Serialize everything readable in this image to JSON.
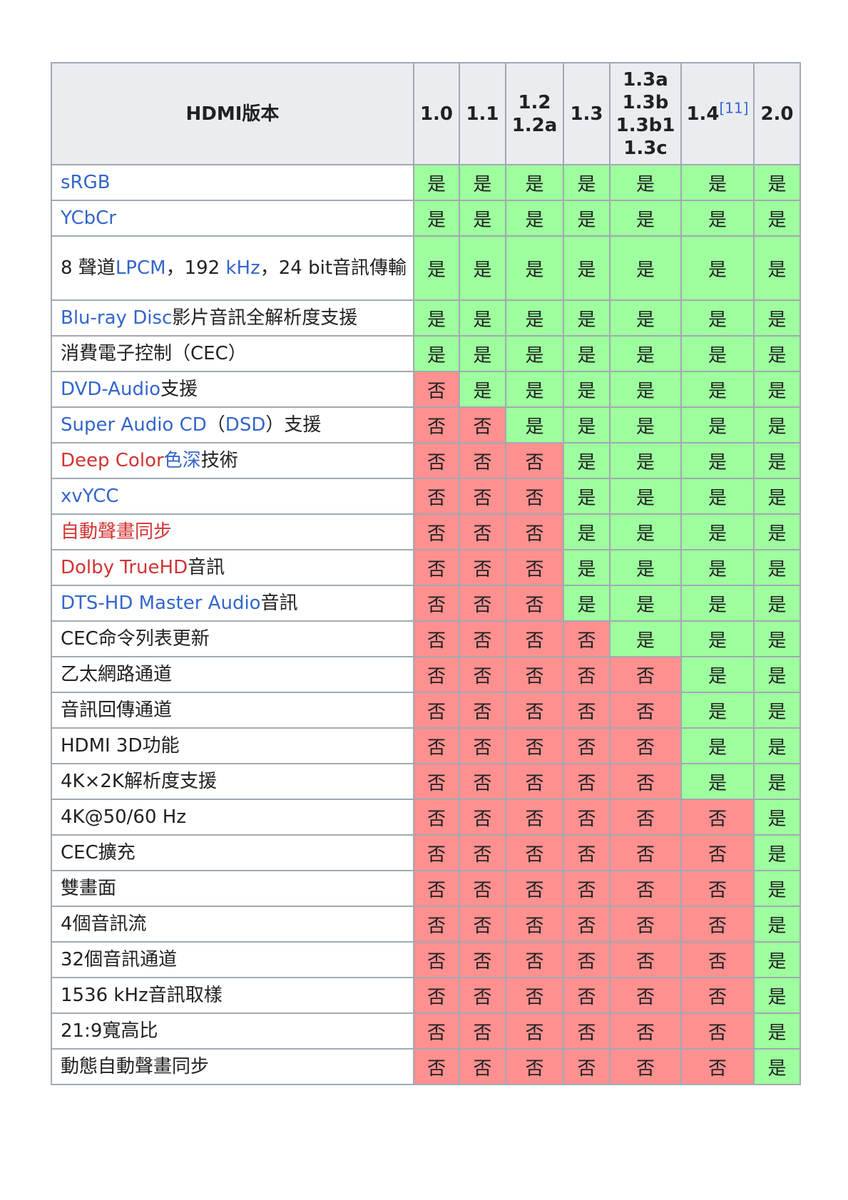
{
  "table": {
    "header_label": "HDMI版本",
    "versions": [
      {
        "lines": [
          "1.0"
        ]
      },
      {
        "lines": [
          "1.1"
        ]
      },
      {
        "lines": [
          "1.2",
          "1.2a"
        ]
      },
      {
        "lines": [
          "1.3"
        ]
      },
      {
        "lines": [
          "1.3a",
          "1.3b",
          "1.3b1",
          "1.3c"
        ]
      },
      {
        "lines": [
          "1.4"
        ],
        "ref": "[11]"
      },
      {
        "lines": [
          "2.0"
        ]
      }
    ],
    "yes_label": "是",
    "no_label": "否",
    "colors": {
      "yes_bg": "#9eff9e",
      "no_bg": "#ff9090",
      "header_bg": "#eaecf0",
      "link": "#3366cc",
      "new_link": "#d33333",
      "border": "#a2a9b1"
    },
    "rows": [
      {
        "segments": [
          {
            "text": "sRGB",
            "style": "link"
          }
        ],
        "support": [
          1,
          1,
          1,
          1,
          1,
          1,
          1
        ]
      },
      {
        "segments": [
          {
            "text": "YCbCr",
            "style": "link"
          }
        ],
        "support": [
          1,
          1,
          1,
          1,
          1,
          1,
          1
        ]
      },
      {
        "segments": [
          {
            "text": "8 聲道",
            "style": "plain"
          },
          {
            "text": "LPCM",
            "style": "link"
          },
          {
            "text": "，192 ",
            "style": "plain"
          },
          {
            "text": "kHz",
            "style": "link"
          },
          {
            "text": "，24 bit音訊傳輸",
            "style": "plain"
          }
        ],
        "support": [
          1,
          1,
          1,
          1,
          1,
          1,
          1
        ],
        "tall": true
      },
      {
        "segments": [
          {
            "text": "Blu-ray Disc",
            "style": "link"
          },
          {
            "text": "影片音訊全解析度支援",
            "style": "plain"
          }
        ],
        "support": [
          1,
          1,
          1,
          1,
          1,
          1,
          1
        ]
      },
      {
        "segments": [
          {
            "text": "消費電子控制（CEC）",
            "style": "plain"
          }
        ],
        "support": [
          1,
          1,
          1,
          1,
          1,
          1,
          1
        ]
      },
      {
        "segments": [
          {
            "text": "DVD-Audio",
            "style": "link"
          },
          {
            "text": "支援",
            "style": "plain"
          }
        ],
        "support": [
          0,
          1,
          1,
          1,
          1,
          1,
          1
        ]
      },
      {
        "segments": [
          {
            "text": "Super Audio CD",
            "style": "link"
          },
          {
            "text": "（",
            "style": "plain"
          },
          {
            "text": "DSD",
            "style": "link"
          },
          {
            "text": "）支援",
            "style": "plain"
          }
        ],
        "support": [
          0,
          0,
          1,
          1,
          1,
          1,
          1
        ]
      },
      {
        "segments": [
          {
            "text": "Deep Color",
            "style": "new"
          },
          {
            "text": "色深",
            "style": "link"
          },
          {
            "text": "技術",
            "style": "plain"
          }
        ],
        "support": [
          0,
          0,
          0,
          1,
          1,
          1,
          1
        ]
      },
      {
        "segments": [
          {
            "text": "xvYCC",
            "style": "link"
          }
        ],
        "support": [
          0,
          0,
          0,
          1,
          1,
          1,
          1
        ]
      },
      {
        "segments": [
          {
            "text": "自動聲畫同步",
            "style": "new"
          }
        ],
        "support": [
          0,
          0,
          0,
          1,
          1,
          1,
          1
        ]
      },
      {
        "segments": [
          {
            "text": "Dolby TrueHD",
            "style": "new"
          },
          {
            "text": "音訊",
            "style": "plain"
          }
        ],
        "support": [
          0,
          0,
          0,
          1,
          1,
          1,
          1
        ]
      },
      {
        "segments": [
          {
            "text": "DTS-HD Master Audio",
            "style": "link"
          },
          {
            "text": "音訊",
            "style": "plain"
          }
        ],
        "support": [
          0,
          0,
          0,
          1,
          1,
          1,
          1
        ]
      },
      {
        "segments": [
          {
            "text": "CEC命令列表更新",
            "style": "plain"
          }
        ],
        "support": [
          0,
          0,
          0,
          0,
          1,
          1,
          1
        ]
      },
      {
        "segments": [
          {
            "text": "乙太網路通道",
            "style": "plain"
          }
        ],
        "support": [
          0,
          0,
          0,
          0,
          0,
          1,
          1
        ]
      },
      {
        "segments": [
          {
            "text": "音訊回傳通道",
            "style": "plain"
          }
        ],
        "support": [
          0,
          0,
          0,
          0,
          0,
          1,
          1
        ]
      },
      {
        "segments": [
          {
            "text": "HDMI 3D功能",
            "style": "plain"
          }
        ],
        "support": [
          0,
          0,
          0,
          0,
          0,
          1,
          1
        ]
      },
      {
        "segments": [
          {
            "text": "4K×2K解析度支援",
            "style": "plain"
          }
        ],
        "support": [
          0,
          0,
          0,
          0,
          0,
          1,
          1
        ]
      },
      {
        "segments": [
          {
            "text": "4K@50/60 Hz",
            "style": "plain"
          }
        ],
        "support": [
          0,
          0,
          0,
          0,
          0,
          0,
          1
        ]
      },
      {
        "segments": [
          {
            "text": "CEC擴充",
            "style": "plain"
          }
        ],
        "support": [
          0,
          0,
          0,
          0,
          0,
          0,
          1
        ]
      },
      {
        "segments": [
          {
            "text": "雙畫面",
            "style": "plain"
          }
        ],
        "support": [
          0,
          0,
          0,
          0,
          0,
          0,
          1
        ]
      },
      {
        "segments": [
          {
            "text": "4個音訊流",
            "style": "plain"
          }
        ],
        "support": [
          0,
          0,
          0,
          0,
          0,
          0,
          1
        ]
      },
      {
        "segments": [
          {
            "text": "32個音訊通道",
            "style": "plain"
          }
        ],
        "support": [
          0,
          0,
          0,
          0,
          0,
          0,
          1
        ]
      },
      {
        "segments": [
          {
            "text": "1536 kHz音訊取樣",
            "style": "plain"
          }
        ],
        "support": [
          0,
          0,
          0,
          0,
          0,
          0,
          1
        ]
      },
      {
        "segments": [
          {
            "text": "21:9寬高比",
            "style": "plain"
          }
        ],
        "support": [
          0,
          0,
          0,
          0,
          0,
          0,
          1
        ]
      },
      {
        "segments": [
          {
            "text": "動態自動聲畫同步",
            "style": "plain"
          }
        ],
        "support": [
          0,
          0,
          0,
          0,
          0,
          0,
          1
        ]
      }
    ]
  }
}
